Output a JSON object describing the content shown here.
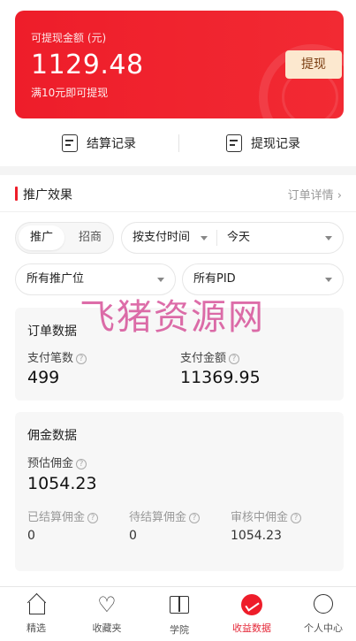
{
  "balance_card": {
    "label": "可提现金额 (元)",
    "amount": "1129.48",
    "note": "满10元即可提现",
    "withdraw_button": "提现"
  },
  "quick_links": {
    "settlement": "结算记录",
    "withdraw_records": "提现记录"
  },
  "section": {
    "title": "推广效果",
    "more": "订单详情 ›"
  },
  "filters": {
    "segment_active": "推广",
    "segment_inactive": "招商",
    "time_type": "按支付时间",
    "period": "今天",
    "position": "所有推广位",
    "pid": "所有PID"
  },
  "order_data": {
    "title": "订单数据",
    "count_label": "支付笔数",
    "count_value": "499",
    "amount_label": "支付金额",
    "amount_value": "11369.95"
  },
  "commission_data": {
    "title": "佣金数据",
    "estimated_label": "预估佣金",
    "estimated_value": "1054.23",
    "settled_label": "已结算佣金",
    "settled_value": "0",
    "pending_label": "待结算佣金",
    "pending_value": "0",
    "review_label": "审核中佣金",
    "review_value": "1054.23"
  },
  "watermark": "飞猪资源网",
  "tabbar": [
    {
      "label": "精选",
      "icon": "home-icon"
    },
    {
      "label": "收藏夹",
      "icon": "heart-icon"
    },
    {
      "label": "学院",
      "icon": "book-icon"
    },
    {
      "label": "收益数据",
      "icon": "chart-icon"
    },
    {
      "label": "个人中心",
      "icon": "person-icon"
    }
  ],
  "colors": {
    "accent": "#ee1d2a",
    "withdraw_button_bg": "#fce8cf"
  }
}
